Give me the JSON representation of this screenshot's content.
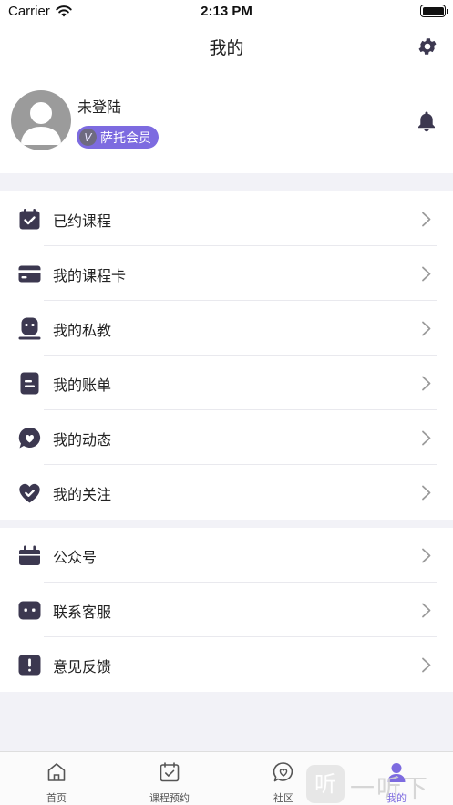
{
  "status_bar": {
    "carrier": "Carrier",
    "time": "2:13 PM"
  },
  "nav": {
    "title": "我的"
  },
  "profile": {
    "name": "未登陆",
    "vip_icon_letter": "V",
    "vip_label": "萨托会员"
  },
  "colors": {
    "accent": "#7d6be0",
    "icon_dark": "#3c3850",
    "background_gray": "#f2f2f7",
    "avatar_gray": "#9b9b9b"
  },
  "menu_group_1": [
    {
      "label": "已约课程",
      "icon": "calendar-check-icon"
    },
    {
      "label": "我的课程卡",
      "icon": "card-icon"
    },
    {
      "label": "我的私教",
      "icon": "coach-icon"
    },
    {
      "label": "我的账单",
      "icon": "bill-icon"
    },
    {
      "label": "我的动态",
      "icon": "heart-bubble-icon"
    },
    {
      "label": "我的关注",
      "icon": "heart-check-icon"
    }
  ],
  "menu_group_2": [
    {
      "label": "公众号",
      "icon": "official-account-icon"
    },
    {
      "label": "联系客服",
      "icon": "customer-service-icon"
    },
    {
      "label": "意见反馈",
      "icon": "feedback-icon"
    }
  ],
  "tab_bar": {
    "tabs": [
      {
        "label": "首页",
        "icon": "home-icon"
      },
      {
        "label": "课程预约",
        "icon": "calendar-check-icon"
      },
      {
        "label": "社区",
        "icon": "heart-bubble-icon"
      },
      {
        "label": "我的",
        "icon": "person-icon",
        "active": true
      }
    ]
  },
  "watermark": {
    "glyph": "听",
    "text": "一听下载"
  }
}
